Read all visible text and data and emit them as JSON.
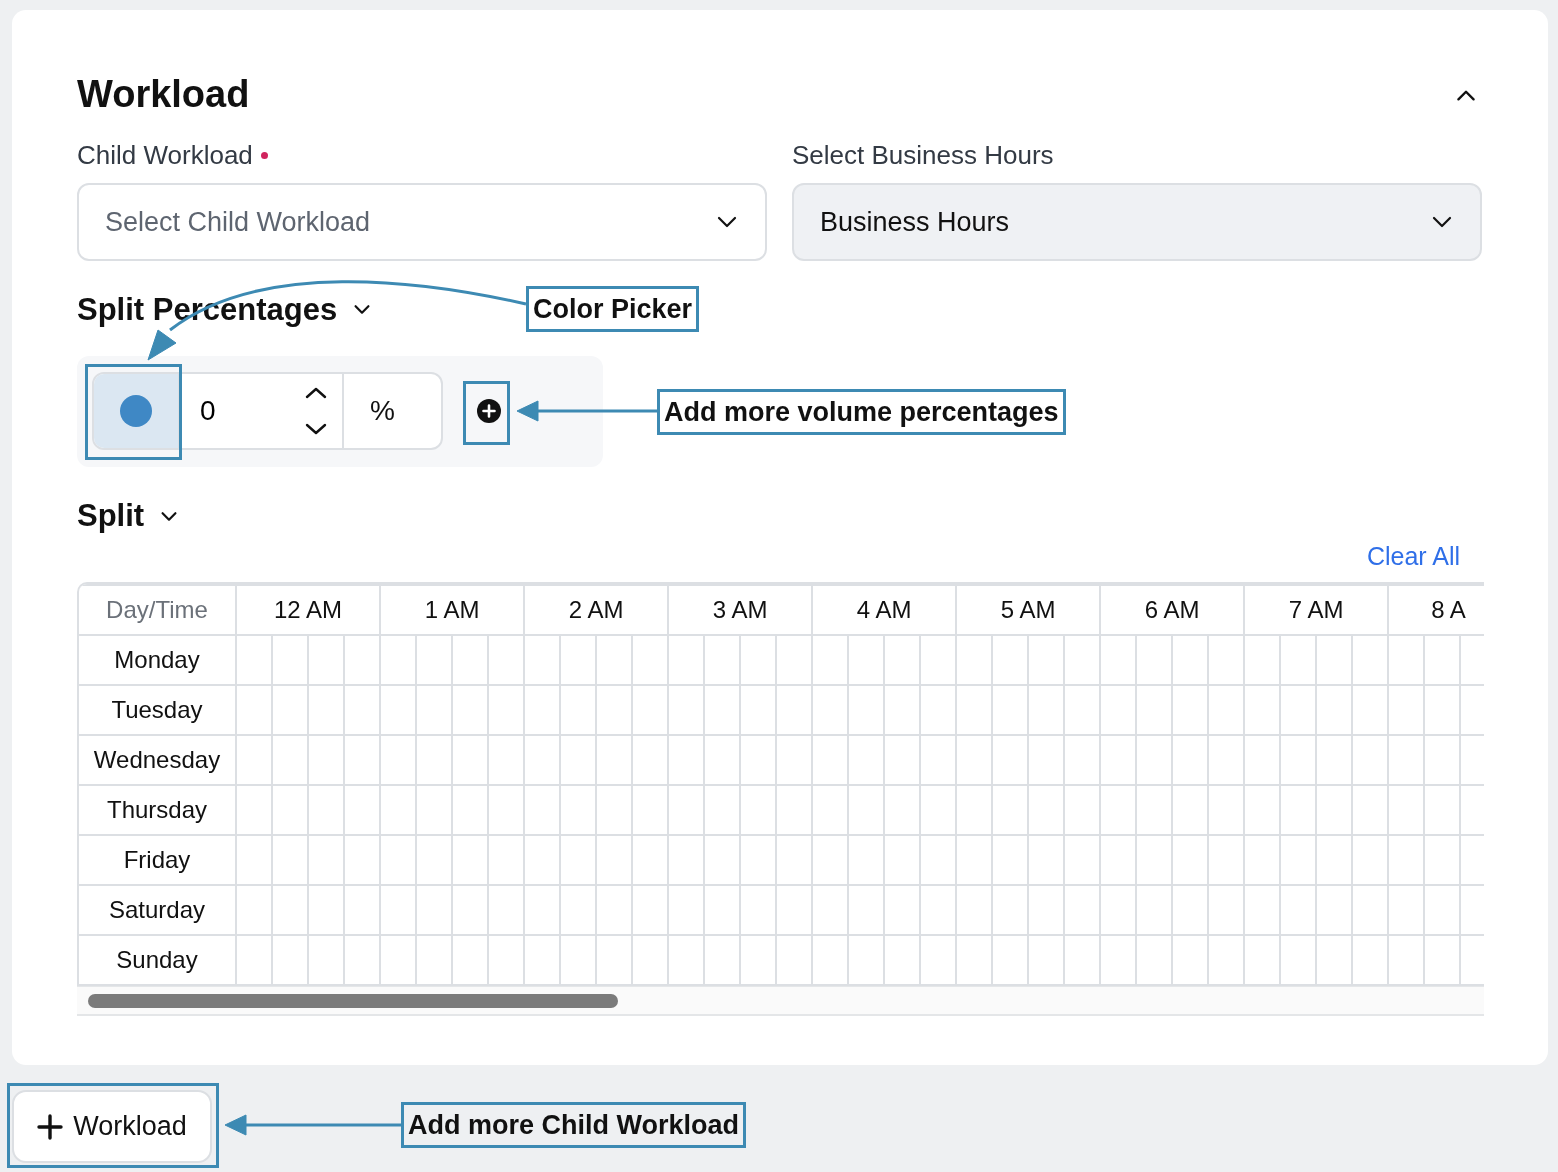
{
  "section": {
    "title": "Workload"
  },
  "fields": [
    {
      "label": "Child Workload",
      "required": true,
      "placeholder": "Select Child Workload",
      "disabled": false
    },
    {
      "label": "Select Business Hours",
      "value": "Business Hours",
      "disabled": true
    }
  ],
  "split_percentages": {
    "title": "Split Percentages",
    "color": "#3f88c5",
    "value": "0",
    "unit": "%"
  },
  "split": {
    "title": "Split",
    "clear_link": "Clear All",
    "corner": "Day/Time",
    "hours": [
      "12 AM",
      "1 AM",
      "2 AM",
      "3 AM",
      "4 AM",
      "5 AM",
      "6 AM",
      "7 AM",
      "8 A"
    ],
    "days": [
      "Monday",
      "Tuesday",
      "Wednesday",
      "Thursday",
      "Friday",
      "Saturday",
      "Sunday"
    ]
  },
  "add_button": {
    "label": "Workload"
  },
  "annotations": [
    {
      "text": "Color Picker"
    },
    {
      "text": "Add more volume percentages"
    },
    {
      "text": "Add more Child Workload"
    }
  ]
}
